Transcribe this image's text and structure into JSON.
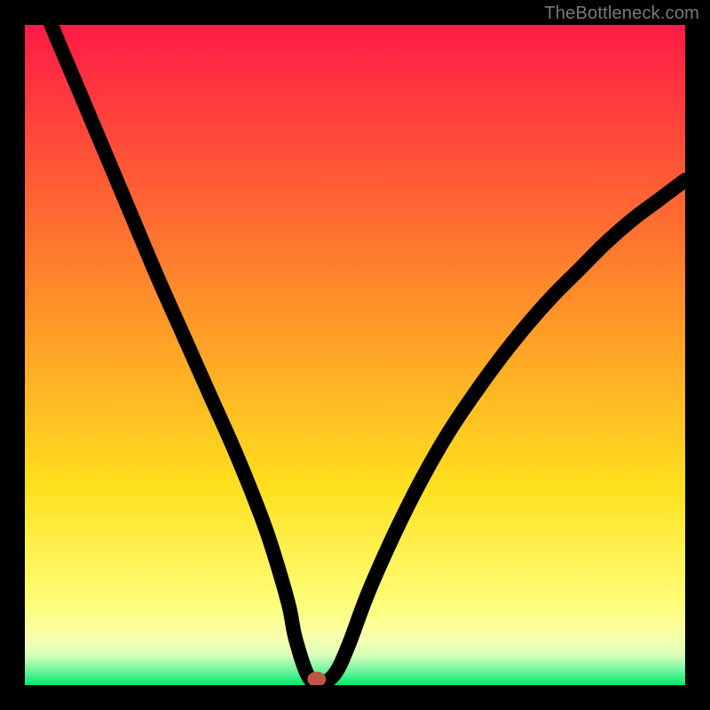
{
  "watermark": "TheBottleneck.com",
  "chart_data": {
    "type": "line",
    "title": "",
    "xlabel": "",
    "ylabel": "",
    "xlim": [
      0,
      100
    ],
    "ylim": [
      0,
      100
    ],
    "grid": false,
    "legend": false,
    "background_gradient": {
      "stops": [
        {
          "offset": 0.0,
          "color": "#ff1a46"
        },
        {
          "offset": 0.4,
          "color": "#ff8a2a"
        },
        {
          "offset": 0.7,
          "color": "#ffe01e"
        },
        {
          "offset": 0.88,
          "color": "#ffff7a"
        },
        {
          "offset": 0.93,
          "color": "#f6ffb0"
        },
        {
          "offset": 0.955,
          "color": "#d8ffb8"
        },
        {
          "offset": 0.975,
          "color": "#7cf7a5"
        },
        {
          "offset": 1.0,
          "color": "#00e96b"
        }
      ]
    },
    "series": [
      {
        "name": "bottleneck-curve",
        "x": [
          0,
          4,
          8,
          12,
          16,
          20,
          24,
          28,
          32,
          36,
          38,
          40,
          41,
          43,
          45,
          47,
          49,
          52,
          56,
          60,
          64,
          68,
          72,
          76,
          80,
          84,
          88,
          92,
          96,
          100
        ],
        "y": [
          110,
          100,
          90.5,
          81,
          71.5,
          62,
          53,
          44,
          35,
          25,
          19,
          12,
          7,
          1.2,
          0.4,
          1.8,
          6,
          14,
          23,
          31,
          38,
          44,
          49.5,
          54.5,
          59,
          63,
          67,
          70.5,
          73.5,
          76.5
        ]
      }
    ],
    "marker": {
      "name": "minimum-point",
      "x": 44.2,
      "y": 0.9,
      "rx": 0.9,
      "ry": 0.65,
      "color": "#c0564a"
    }
  }
}
